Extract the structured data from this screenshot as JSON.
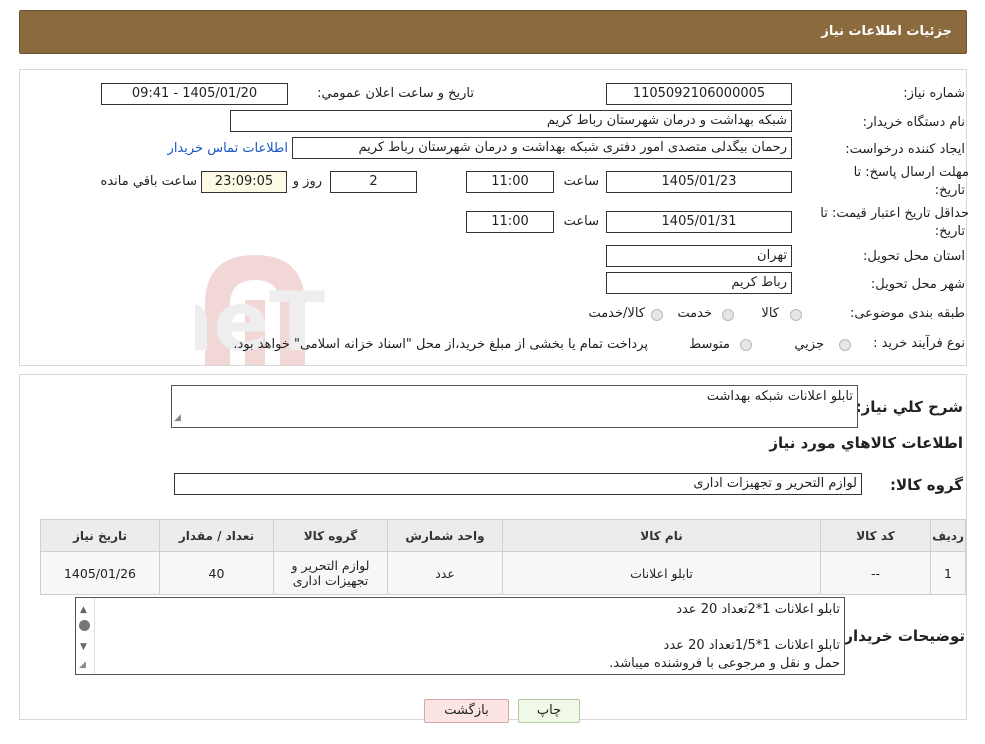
{
  "header": {
    "title": "جزئیات اطلاعات نیاز"
  },
  "form": {
    "need_number_label": "شماره نیاز:",
    "need_number": "1105092106000005",
    "announce_label": "تاریخ و ساعت اعلان عمومي:",
    "announce_value": "1405/01/20 - 09:41",
    "buyer_org_label": "نام دستگاه خریدار:",
    "buyer_org": "شبکه بهداشت و درمان شهرستان رباط کریم",
    "creator_label": "ایجاد کننده درخواست:",
    "creator": "رحمان بیگدلی متصدی امور دفتری شبکه بهداشت و درمان شهرستان رباط کریم",
    "contact_link": "اطلاعات تماس خریدار",
    "deadline_label_1": "مهلت ارسال پاسخ: تا",
    "deadline_label_2": "تاریخ:",
    "deadline_date": "1405/01/23",
    "time_label": "ساعت",
    "deadline_time": "11:00",
    "days_value": "2",
    "days_label": "روز و",
    "remaining_time": "23:09:05",
    "remaining_label": "ساعت باقي مانده",
    "validity_label_1": "حداقل تاریخ اعتبار قیمت: تا",
    "validity_label_2": "تاریخ:",
    "validity_date": "1405/01/31",
    "validity_time": "11:00",
    "province_label": "استان محل تحویل:",
    "province": "تهران",
    "city_label": "شهر محل تحویل:",
    "city": "رباط کریم",
    "category_label": "طبقه بندی موضوعی:",
    "category_options": [
      "کالا",
      "خدمت",
      "کالا/خدمت"
    ],
    "process_label": "نوع فرآیند خرید :",
    "process_options": [
      "جزيي",
      "متوسط"
    ],
    "process_note": "پرداخت تمام یا بخشی از مبلغ خرید،از محل \"اسناد خزانه اسلامی\" خواهد بود."
  },
  "summary": {
    "description_label": "شرح کلي نیاز:",
    "description": "تابلو اعلانات شبکه بهداشت",
    "goods_info_title": "اطلاعات کالاهاي مورد نیاز",
    "goods_group_label": "گروه کالا:",
    "goods_group": "لوازم التحریر و تجهیزات اداری"
  },
  "table": {
    "headers": [
      "ردیف",
      "کد کالا",
      "نام کالا",
      "واحد شمارش",
      "گروه کالا",
      "تعداد / مقدار",
      "تاریخ نیاز"
    ],
    "rows": [
      [
        "1",
        "--",
        "تابلو اعلانات",
        "عدد",
        "لوازم التحریر و تجهیزات اداری",
        "40",
        "1405/01/26"
      ]
    ]
  },
  "notes": {
    "label": "توضیحات خریدار:",
    "line1": "تابلو اعلانات 1*2تعداد 20 عدد",
    "line2": "تابلو اعلانات 1*1/5تعداد 20 عدد",
    "line3": "حمل و نقل و مرجوعی با فروشنده میباشد."
  },
  "buttons": {
    "print": "چاپ",
    "back": "بازگشت"
  },
  "watermark": {
    "text": "AriaTender.neT"
  }
}
